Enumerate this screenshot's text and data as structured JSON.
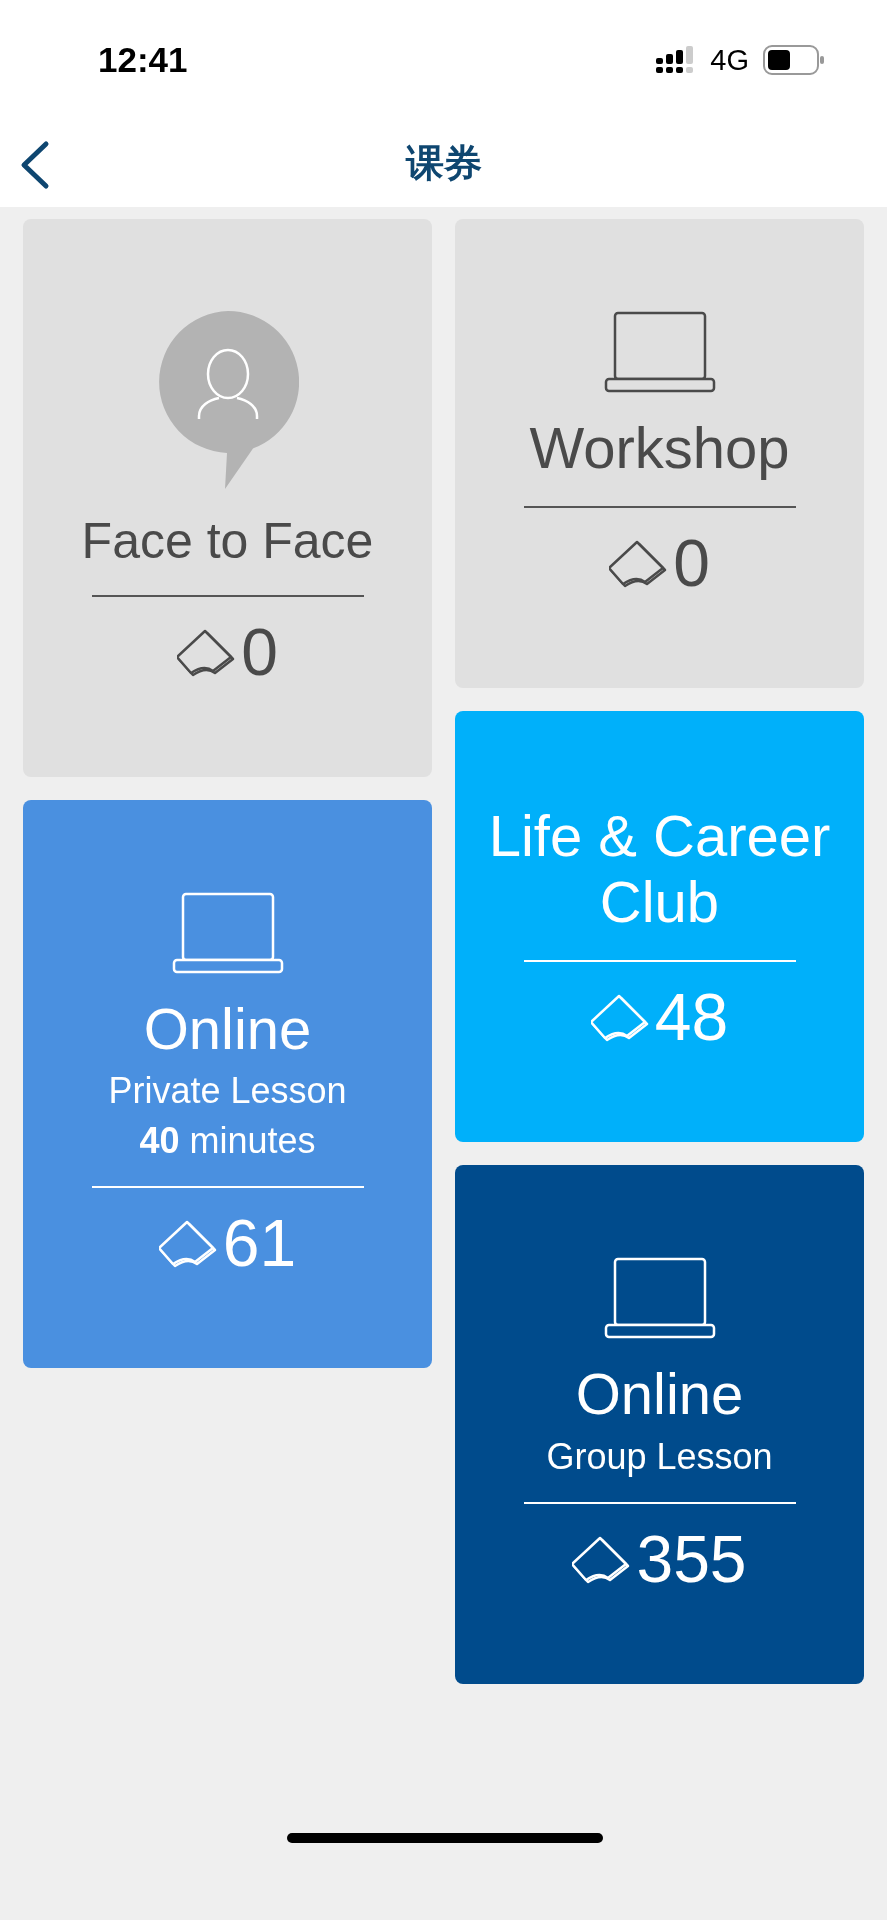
{
  "status_bar": {
    "time": "12:41",
    "network": "4G"
  },
  "nav": {
    "title": "课券"
  },
  "columns": [
    {
      "cards": [
        {
          "kind": "avatar",
          "color": "#e0e0e0",
          "title": "Face to Face",
          "count": "0"
        },
        {
          "kind": "laptop",
          "color": "#4a90e0",
          "title": "Online",
          "subtitles": [
            "Private Lesson",
            "**40** minutes"
          ],
          "count": "61"
        }
      ]
    },
    {
      "cards": [
        {
          "kind": "laptop",
          "color": "#e0e0e0",
          "title": "Workshop",
          "count": "0"
        },
        {
          "kind": "text",
          "color": "#00b0fa",
          "title": "Life & Career Club",
          "count": "48"
        },
        {
          "kind": "laptop",
          "color": "#004b8c",
          "title": "Online",
          "subtitles": [
            "Group Lesson"
          ],
          "count": "355"
        }
      ]
    }
  ]
}
